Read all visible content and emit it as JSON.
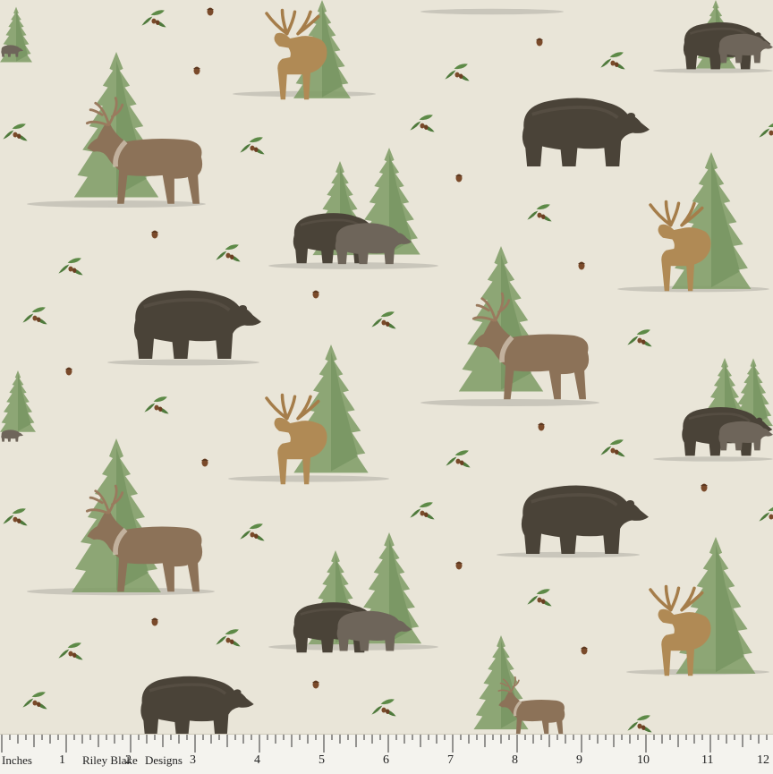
{
  "image": {
    "kind": "fabric-swatch",
    "motifs": [
      "bear-icon",
      "reindeer-icon",
      "moose-icon",
      "pine-tree-icon",
      "acorn-icon",
      "oak-leaf-icon"
    ],
    "colors": {
      "background": "#e9e5d8",
      "pine": "#7f9d66",
      "bear_dark": "#4a4338",
      "bear_light": "#6e655a",
      "reindeer_body": "#8c7258",
      "moose_body": "#b08a55",
      "antler": "#9a7a5e",
      "acorn": "#7a4a2a",
      "leaf": "#4f7a3c"
    }
  },
  "ruler": {
    "unit_label": "Inches",
    "brand_left": "Riley Blake",
    "brand_right": "Designs",
    "numbers": [
      "1",
      "2",
      "3",
      "4",
      "5",
      "6",
      "7",
      "8",
      "9",
      "10",
      "11",
      "12"
    ]
  }
}
